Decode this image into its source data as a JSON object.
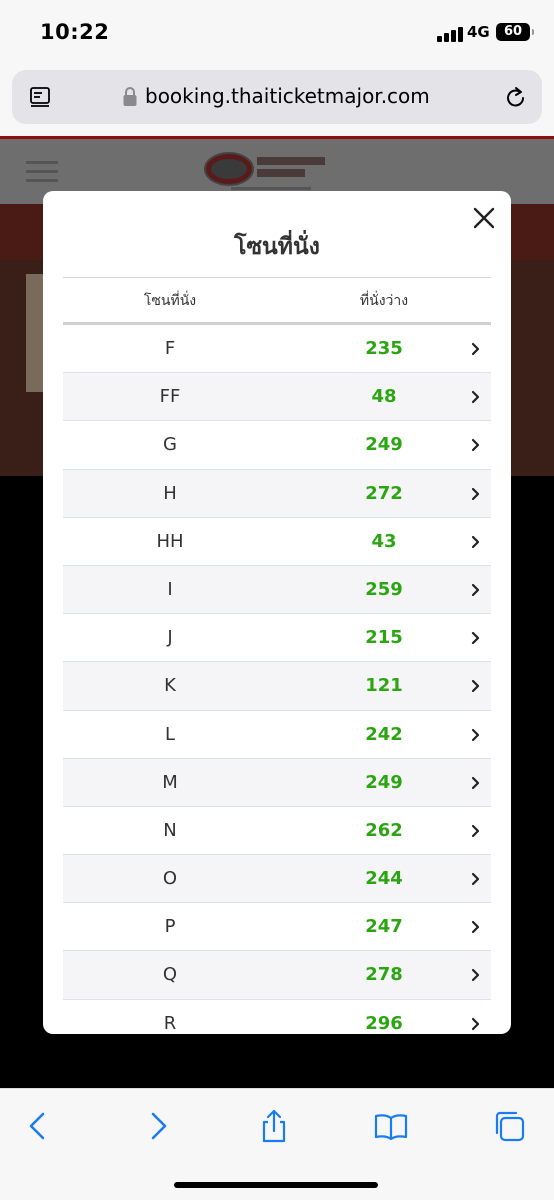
{
  "status": {
    "time": "10:22",
    "network": "4G",
    "battery": "60"
  },
  "browser": {
    "url": "booking.thaiticketmajor.com"
  },
  "modal": {
    "title": "โซนที่นั่ง",
    "headers": {
      "zone": "โซนที่นั่ง",
      "available": "ที่นั่งว่าง"
    },
    "rows": [
      {
        "zone": "F",
        "available": "235"
      },
      {
        "zone": "FF",
        "available": "48"
      },
      {
        "zone": "G",
        "available": "249"
      },
      {
        "zone": "H",
        "available": "272"
      },
      {
        "zone": "HH",
        "available": "43"
      },
      {
        "zone": "I",
        "available": "259"
      },
      {
        "zone": "J",
        "available": "215"
      },
      {
        "zone": "K",
        "available": "121"
      },
      {
        "zone": "L",
        "available": "242"
      },
      {
        "zone": "M",
        "available": "249"
      },
      {
        "zone": "N",
        "available": "262"
      },
      {
        "zone": "O",
        "available": "244"
      },
      {
        "zone": "P",
        "available": "247"
      },
      {
        "zone": "Q",
        "available": "278"
      },
      {
        "zone": "R",
        "available": "296"
      }
    ]
  },
  "colors": {
    "available_green": "#2ba612",
    "ios_blue": "#1a7cf4",
    "brand_red": "#8a1010"
  },
  "icons": {
    "toolbar": [
      "back-icon",
      "forward-icon",
      "share-icon",
      "bookmarks-icon",
      "tabs-icon"
    ]
  }
}
